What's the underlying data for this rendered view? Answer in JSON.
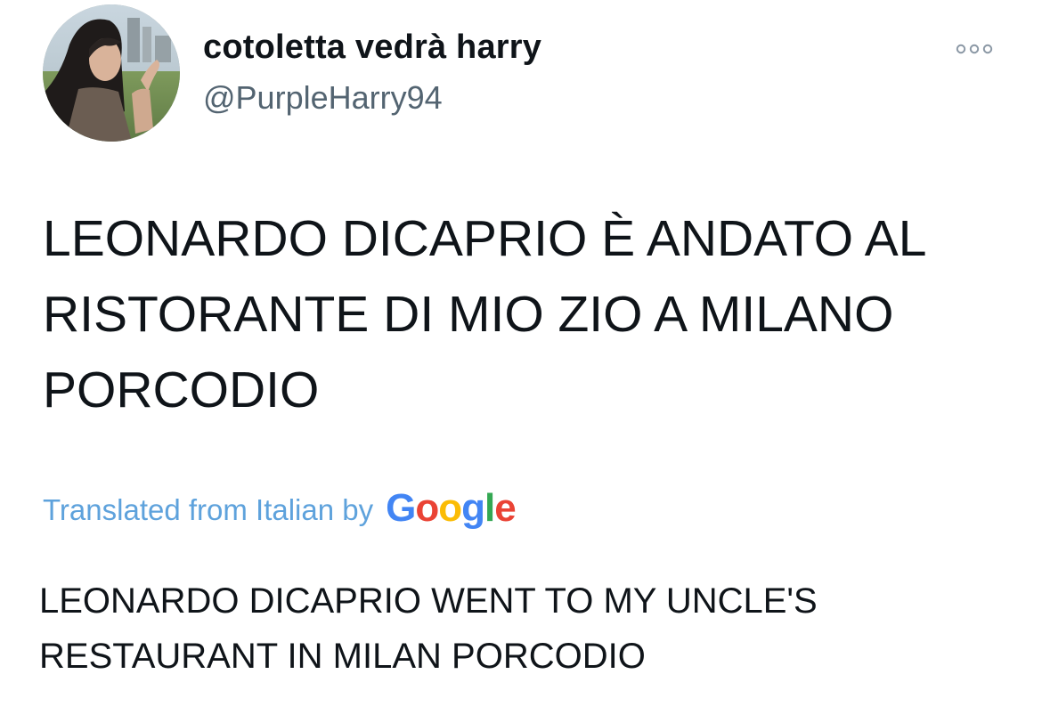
{
  "author": {
    "display_name": "cotoletta vedrà harry",
    "handle": "@PurpleHarry94"
  },
  "tweet": {
    "lines": [
      "LEONARDO DICAPRIO È ANDATO AL",
      "RISTORANTE DI MIO ZIO A MILANO",
      "PORCODIO"
    ]
  },
  "translation": {
    "label": "Translated from Italian by",
    "provider_letters": [
      "G",
      "o",
      "o",
      "g",
      "l",
      "e"
    ],
    "provider_colors": [
      "#4285f4",
      "#ea4335",
      "#fbbc05",
      "#4285f4",
      "#34a853",
      "#ea4335"
    ],
    "lines": [
      "LEONARDO DICAPRIO WENT TO MY UNCLE'S",
      "RESTAURANT IN MILAN PORCODIO"
    ]
  },
  "icons": {
    "more": "more-options-icon",
    "avatar": "profile-photo"
  },
  "colors": {
    "text": "#0f1419",
    "secondary": "#536471",
    "link": "#5ea2dc"
  }
}
